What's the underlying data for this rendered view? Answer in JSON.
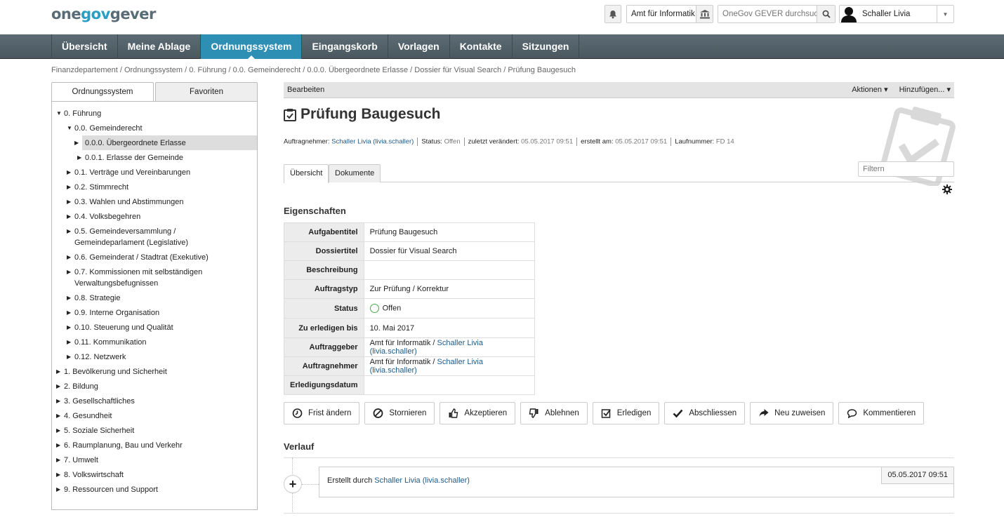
{
  "header": {
    "logo_one": "one",
    "logo_gov": "gov",
    "logo_gever": "gever",
    "org_unit": "Amt für Informatik",
    "search_placeholder": "OneGov GEVER durchsuchen",
    "user_name": "Schaller Livia"
  },
  "nav": {
    "items": [
      "Übersicht",
      "Meine Ablage",
      "Ordnungssystem",
      "Eingangskorb",
      "Vorlagen",
      "Kontakte",
      "Sitzungen"
    ],
    "active": "Ordnungssystem"
  },
  "breadcrumb": "Finanzdepartement / Ordnungssystem / 0. Führung / 0.0. Gemeinderecht / 0.0.0. Übergeordnete Erlasse / Dossier für Visual Search / Prüfung Baugesuch",
  "sidebar": {
    "tabs": [
      "Ordnungssystem",
      "Favoriten"
    ],
    "tree": [
      {
        "label": "0. Führung",
        "level": 0,
        "expanded": true
      },
      {
        "label": "0.0. Gemeinderecht",
        "level": 1,
        "expanded": true
      },
      {
        "label": "0.0.0. Übergeordnete Erlasse",
        "level": 2,
        "selected": true
      },
      {
        "label": "0.0.1. Erlasse der Gemeinde",
        "level": 2
      },
      {
        "label": "0.1. Verträge und Vereinbarungen",
        "level": 1
      },
      {
        "label": "0.2. Stimmrecht",
        "level": 1
      },
      {
        "label": "0.3. Wahlen und Abstimmungen",
        "level": 1
      },
      {
        "label": "0.4. Volksbegehren",
        "level": 1
      },
      {
        "label": "0.5. Gemeindeversammlung / Gemeindeparlament (Legislative)",
        "level": 1
      },
      {
        "label": "0.6. Gemeinderat / Stadtrat (Exekutive)",
        "level": 1
      },
      {
        "label": "0.7. Kommissionen mit selbständigen Verwaltungsbefugnissen",
        "level": 1
      },
      {
        "label": "0.8. Strategie",
        "level": 1
      },
      {
        "label": "0.9. Interne Organisation",
        "level": 1
      },
      {
        "label": "0.10. Steuerung und Qualität",
        "level": 1
      },
      {
        "label": "0.11. Kommunikation",
        "level": 1
      },
      {
        "label": "0.12. Netzwerk",
        "level": 1
      },
      {
        "label": "1. Bevölkerung und Sicherheit",
        "level": 0
      },
      {
        "label": "2. Bildung",
        "level": 0
      },
      {
        "label": "3. Gesellschaftliches",
        "level": 0
      },
      {
        "label": "4. Gesundheit",
        "level": 0
      },
      {
        "label": "5. Soziale Sicherheit",
        "level": 0
      },
      {
        "label": "6. Raumplanung, Bau und Verkehr",
        "level": 0
      },
      {
        "label": "7. Umwelt",
        "level": 0
      },
      {
        "label": "8. Volkswirtschaft",
        "level": 0
      },
      {
        "label": "9. Ressourcen und Support",
        "level": 0
      }
    ]
  },
  "toolbar": {
    "edit": "Bearbeiten",
    "actions": "Aktionen ▾",
    "add": "Hinzufügen... ▾"
  },
  "task": {
    "title": "Prüfung Baugesuch",
    "meta": {
      "assignee_label": "Auftragnehmer:",
      "assignee": "Schaller Livia (livia.schaller)",
      "status_label": "Status:",
      "status": "Offen",
      "modified_label": "zuletzt verändert:",
      "modified": "05.05.2017 09:51",
      "created_label": "erstellt am:",
      "created": "05.05.2017 09:51",
      "seq_label": "Laufnummer:",
      "seq": "FD 14"
    }
  },
  "content_tabs": [
    "Übersicht",
    "Dokumente"
  ],
  "filter_placeholder": "Filtern",
  "properties": {
    "heading": "Eigenschaften",
    "rows": [
      {
        "key": "Aufgabentitel",
        "value": "Prüfung Baugesuch"
      },
      {
        "key": "Dossiertitel",
        "value": "Dossier für Visual Search"
      },
      {
        "key": "Beschreibung",
        "value": ""
      },
      {
        "key": "Auftragstyp",
        "value": "Zur Prüfung / Korrektur"
      },
      {
        "key": "Status",
        "value": "Offen"
      },
      {
        "key": "Zu erledigen bis",
        "value": "10. Mai 2017"
      },
      {
        "key": "Auftraggeber",
        "value_prefix": "Amt für Informatik / ",
        "value_link": "Schaller Livia (livia.schaller)"
      },
      {
        "key": "Auftragnehmer",
        "value_prefix": "Amt für Informatik / ",
        "value_link": "Schaller Livia (livia.schaller)"
      },
      {
        "key": "Erledigungsdatum",
        "value": ""
      }
    ]
  },
  "actions": [
    {
      "label": "Frist ändern",
      "icon": "clock-icon"
    },
    {
      "label": "Stornieren",
      "icon": "ban-icon"
    },
    {
      "label": "Akzeptieren",
      "icon": "thumbs-up-icon"
    },
    {
      "label": "Ablehnen",
      "icon": "thumbs-down-icon"
    },
    {
      "label": "Erledigen",
      "icon": "check-square-icon"
    },
    {
      "label": "Abschliessen",
      "icon": "check-icon"
    },
    {
      "label": "Neu zuweisen",
      "icon": "share-arrow-icon"
    },
    {
      "label": "Kommentieren",
      "icon": "comment-icon"
    }
  ],
  "history": {
    "heading": "Verlauf",
    "entries": [
      {
        "text": "Erstellt durch ",
        "link": "Schaller Livia (livia.schaller)",
        "date": "05.05.2017 09:51"
      }
    ]
  },
  "colors": {
    "nav_bg": "#4f5c64",
    "nav_active": "#2d8fb3",
    "link": "#1d5a8a",
    "status_ok": "#4aa84a"
  }
}
